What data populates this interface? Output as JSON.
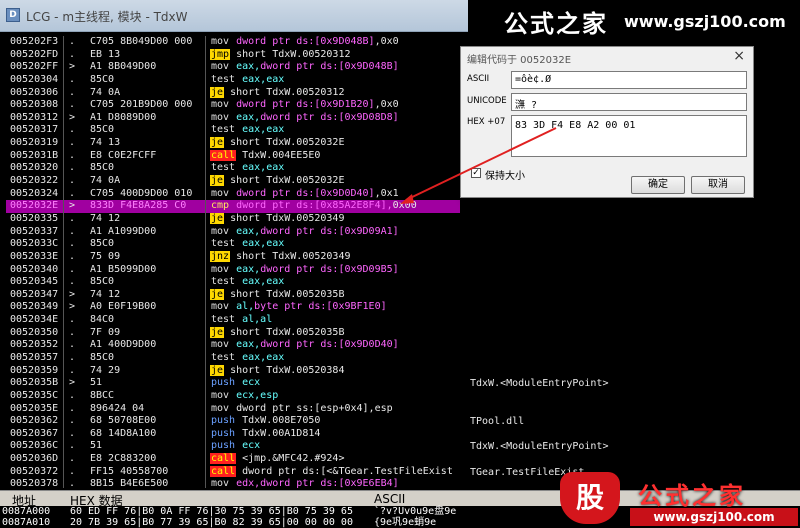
{
  "window": {
    "title": "LCG - m主线程, 模块 - TdxW",
    "icon": "app-icon"
  },
  "watermark_top": {
    "chinese": "公式之家",
    "url": "www.gszj100.com"
  },
  "watermark_bottom": {
    "char": "股",
    "chinese": "公式之家",
    "url": "www.gszj100.com"
  },
  "disasm_rows": [
    {
      "addr": "005202F3",
      "mark": ".",
      "hex": "C705 8B049D00 000",
      "mn": "mov",
      "mnc": "plain",
      "ops": [
        [
          "dword ptr ds:[0x9D048B]",
          "mem"
        ],
        [
          ",0x0",
          "lit"
        ]
      ]
    },
    {
      "addr": "005202FD",
      "mark": ".",
      "hex": "EB 13",
      "mn": "jmp",
      "mnc": "jmp",
      "ops": [
        [
          "short TdxW.00520312",
          "lit"
        ]
      ]
    },
    {
      "addr": "005202FF",
      "mark": ">",
      "hex": "A1 8B049D00",
      "mn": "mov",
      "mnc": "plain",
      "ops": [
        [
          "eax,",
          "reg"
        ],
        [
          "dword ptr ds:[0x9D048B]",
          "mem"
        ]
      ]
    },
    {
      "addr": "00520304",
      "mark": ".",
      "hex": "85C0",
      "mn": "test",
      "mnc": "test",
      "ops": [
        [
          "eax,eax",
          "reg"
        ]
      ]
    },
    {
      "addr": "00520306",
      "mark": ".",
      "hex": "74 0A",
      "mn": "je",
      "mnc": "jmp",
      "ops": [
        [
          "short TdxW.00520312",
          "lit"
        ]
      ]
    },
    {
      "addr": "00520308",
      "mark": ".",
      "hex": "C705 201B9D00 000",
      "mn": "mov",
      "mnc": "plain",
      "ops": [
        [
          "dword ptr ds:[0x9D1B20]",
          "mem"
        ],
        [
          ",0x0",
          "lit"
        ]
      ]
    },
    {
      "addr": "00520312",
      "mark": ">",
      "hex": "A1 D8089D00",
      "mn": "mov",
      "mnc": "plain",
      "ops": [
        [
          "eax,",
          "reg"
        ],
        [
          "dword ptr ds:[0x9D08D8]",
          "mem"
        ]
      ]
    },
    {
      "addr": "00520317",
      "mark": ".",
      "hex": "85C0",
      "mn": "test",
      "mnc": "test",
      "ops": [
        [
          "eax,eax",
          "reg"
        ]
      ]
    },
    {
      "addr": "00520319",
      "mark": ".",
      "hex": "74 13",
      "mn": "je",
      "mnc": "jmp",
      "ops": [
        [
          "short TdxW.0052032E",
          "lit"
        ]
      ]
    },
    {
      "addr": "0052031B",
      "mark": ".",
      "hex": "E8 C0E2FCFF",
      "mn": "call",
      "mnc": "call",
      "ops": [
        [
          "TdxW.004EE5E0",
          "lit"
        ]
      ]
    },
    {
      "addr": "00520320",
      "mark": ".",
      "hex": "85C0",
      "mn": "test",
      "mnc": "test",
      "ops": [
        [
          "eax,eax",
          "reg"
        ]
      ]
    },
    {
      "addr": "00520322",
      "mark": ".",
      "hex": "74 0A",
      "mn": "je",
      "mnc": "jmp",
      "ops": [
        [
          "short TdxW.0052032E",
          "lit"
        ]
      ]
    },
    {
      "addr": "00520324",
      "mark": ".",
      "hex": "C705 400D9D00 010",
      "mn": "mov",
      "mnc": "plain",
      "ops": [
        [
          "dword ptr ds:[0x9D0D40]",
          "mem"
        ],
        [
          ",0x1",
          "lit"
        ]
      ]
    },
    {
      "addr": "0052032E",
      "mark": ">",
      "hex": "833D F4E8A285 C0",
      "mn": "cmp",
      "mnc": "cmp",
      "ops": [
        [
          "dword ptr ds:[0x85A2E8F4],",
          "mem"
        ],
        [
          "0x00",
          "lit"
        ]
      ],
      "sel": true
    },
    {
      "addr": "00520335",
      "mark": ".",
      "hex": "74 12",
      "mn": "je",
      "mnc": "jmp",
      "ops": [
        [
          "short TdxW.00520349",
          "lit"
        ]
      ]
    },
    {
      "addr": "00520337",
      "mark": ".",
      "hex": "A1 A1099D00",
      "mn": "mov",
      "mnc": "plain",
      "ops": [
        [
          "eax,",
          "reg"
        ],
        [
          "dword ptr ds:[0x9D09A1]",
          "mem"
        ]
      ]
    },
    {
      "addr": "0052033C",
      "mark": ".",
      "hex": "85C0",
      "mn": "test",
      "mnc": "test",
      "ops": [
        [
          "eax,eax",
          "reg"
        ]
      ]
    },
    {
      "addr": "0052033E",
      "mark": ".",
      "hex": "75 09",
      "mn": "jnz",
      "mnc": "jmp",
      "ops": [
        [
          "short TdxW.00520349",
          "lit"
        ]
      ]
    },
    {
      "addr": "00520340",
      "mark": ".",
      "hex": "A1 B5099D00",
      "mn": "mov",
      "mnc": "plain",
      "ops": [
        [
          "eax,",
          "reg"
        ],
        [
          "dword ptr ds:[0x9D09B5]",
          "mem"
        ]
      ]
    },
    {
      "addr": "00520345",
      "mark": ".",
      "hex": "85C0",
      "mn": "test",
      "mnc": "test",
      "ops": [
        [
          "eax,eax",
          "reg"
        ]
      ]
    },
    {
      "addr": "00520347",
      "mark": ">",
      "hex": "74 12",
      "mn": "je",
      "mnc": "jmp",
      "ops": [
        [
          "short TdxW.0052035B",
          "lit"
        ]
      ]
    },
    {
      "addr": "00520349",
      "mark": ">",
      "hex": "A0 E0F19B00",
      "mn": "mov",
      "mnc": "plain",
      "ops": [
        [
          "al,",
          "reg"
        ],
        [
          "byte ptr ds:[0x9BF1E0]",
          "mem"
        ]
      ]
    },
    {
      "addr": "0052034E",
      "mark": ".",
      "hex": "84C0",
      "mn": "test",
      "mnc": "test",
      "ops": [
        [
          "al,al",
          "reg"
        ]
      ]
    },
    {
      "addr": "00520350",
      "mark": ".",
      "hex": "7F 09",
      "mn": "je",
      "mnc": "jmp",
      "ops": [
        [
          "short TdxW.0052035B",
          "lit"
        ]
      ]
    },
    {
      "addr": "00520352",
      "mark": ".",
      "hex": "A1 400D9D00",
      "mn": "mov",
      "mnc": "plain",
      "ops": [
        [
          "eax,",
          "reg"
        ],
        [
          "dword ptr ds:[0x9D0D40]",
          "mem"
        ]
      ]
    },
    {
      "addr": "00520357",
      "mark": ".",
      "hex": "85C0",
      "mn": "test",
      "mnc": "test",
      "ops": [
        [
          "eax,eax",
          "reg"
        ]
      ]
    },
    {
      "addr": "00520359",
      "mark": ".",
      "hex": "74 29",
      "mn": "je",
      "mnc": "jmp",
      "ops": [
        [
          "short TdxW.00520384",
          "lit"
        ]
      ]
    },
    {
      "addr": "0052035B",
      "mark": ">",
      "hex": "51",
      "mn": "push",
      "mnc": "push",
      "ops": [
        [
          "ecx",
          "reg"
        ]
      ]
    },
    {
      "addr": "0052035C",
      "mark": ".",
      "hex": "8BCC",
      "mn": "mov",
      "mnc": "plain",
      "ops": [
        [
          "ecx,esp",
          "reg"
        ]
      ]
    },
    {
      "addr": "0052035E",
      "mark": ".",
      "hex": "896424 04",
      "mn": "mov",
      "mnc": "plain",
      "ops": [
        [
          "dword ptr ss:[esp+0x4],esp",
          "lit"
        ]
      ]
    },
    {
      "addr": "00520362",
      "mark": ".",
      "hex": "68 50708E00",
      "mn": "push",
      "mnc": "push",
      "ops": [
        [
          "TdxW.008E7050",
          "lit"
        ]
      ]
    },
    {
      "addr": "00520367",
      "mark": ".",
      "hex": "68 14D8A100",
      "mn": "push",
      "mnc": "push",
      "ops": [
        [
          "TdxW.00A1D814",
          "lit"
        ]
      ]
    },
    {
      "addr": "0052036C",
      "mark": ".",
      "hex": "51",
      "mn": "push",
      "mnc": "push",
      "ops": [
        [
          "ecx",
          "reg"
        ]
      ]
    },
    {
      "addr": "0052036D",
      "mark": ".",
      "hex": "E8 2C883200",
      "mn": "call",
      "mnc": "call",
      "ops": [
        [
          "<jmp.&MFC42.#924>",
          "lit"
        ]
      ]
    },
    {
      "addr": "00520372",
      "mark": ".",
      "hex": "FF15 40558700",
      "mn": "call",
      "mnc": "call",
      "ops": [
        [
          "dword ptr ds:[<&TGear.TestFileExist",
          "lit"
        ]
      ]
    },
    {
      "addr": "00520378",
      "mark": ".",
      "hex": "8B15 B4E6E500",
      "mn": "mov",
      "mnc": "plain",
      "ops": [
        [
          "edx,dword ptr ds:[0x9E6EB4]",
          "mem"
        ]
      ]
    }
  ],
  "comments": [
    {
      "row": 27,
      "text": "TdxW.<ModuleEntryPoint>"
    },
    {
      "row": 30,
      "text": "TPool.dll"
    },
    {
      "row": 32,
      "text": "TdxW.<ModuleEntryPoint>"
    },
    {
      "row": 34,
      "text": "TGear.TestFileExist"
    }
  ],
  "dump": {
    "headers": {
      "addr": "地址",
      "hex": "HEX 数据",
      "ascii": "ASCII"
    },
    "rows": [
      {
        "addr": "0087A000",
        "hex": "60 ED FF 76|B0 0A FF 76|30 75 39 65|B0 75 39 65",
        "ascii": "`?v?Uv0u9e盘9e"
      },
      {
        "addr": "0087A010",
        "hex": "20 7B 39 65|B0 77 39 65|B0 82 39 65|00 00 00 00",
        "ascii": "{9e巩9e蛸9e"
      }
    ]
  },
  "dialog": {
    "title": "编辑代码于 0052032E",
    "ascii_label": "ASCII",
    "ascii_value": "=ôè¢.Ø",
    "unicode_label": "UNICODE",
    "unicode_value": "㶃￴ ￀?",
    "hex_label": "HEX +07",
    "hex_value": "83 3D F4 E8 A2 00 01",
    "keep_size_label": "保持大小",
    "keep_size_checked": "✓",
    "ok_label": "确定",
    "cancel_label": "取消",
    "close_glyph": "×"
  }
}
